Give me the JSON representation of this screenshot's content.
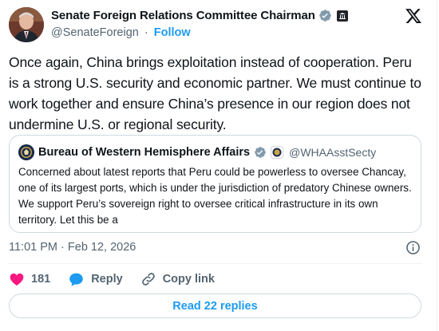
{
  "author": {
    "display_name": "Senate Foreign Relations Committee Chairman",
    "handle": "@SenateForeign",
    "separator": "·",
    "follow_label": "Follow",
    "avatar_icon": "portrait-avatar",
    "verified_color": "#829aab"
  },
  "tweet": {
    "text": "Once again, China brings exploitation instead of cooperation. Peru is a strong U.S. security and economic partner. We must continue to work together and ensure China’s presence in our region does not undermine U.S. or regional security.",
    "time": "11:01 PM",
    "dot": "·",
    "date": "Feb 12, 2026"
  },
  "quote": {
    "display_name": "Bureau of Western Hemisphere Affairs",
    "handle": "@WHAAsstSecty",
    "text": "Concerned about latest reports that Peru could be powerless to oversee Chancay, one of its largest ports, which is under the jurisdiction of predatory Chinese owners.  We support Peru’s sovereign right to oversee critical infrastructure in its own territory.  Let this be a"
  },
  "actions": {
    "likes": "181",
    "reply_label": "Reply",
    "copy_label": "Copy link"
  },
  "replies": {
    "label": "Read 22 replies"
  },
  "colors": {
    "accent": "#1d9bf0",
    "like": "#f91880",
    "text": "#0f1419",
    "muted": "#536471",
    "border": "#cfd9de"
  }
}
